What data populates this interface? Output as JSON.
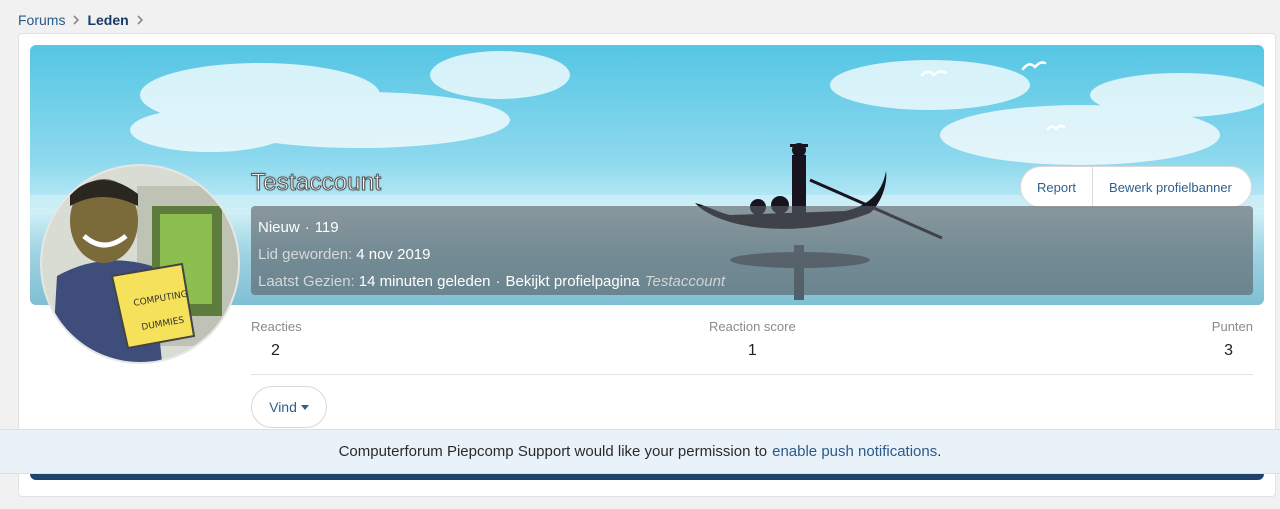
{
  "breadcrumb": {
    "items": [
      {
        "label": "Forums"
      },
      {
        "label": "Leden"
      }
    ]
  },
  "profile": {
    "username": "Testaccount",
    "title": "Nieuw",
    "separator": "·",
    "message_count": "119",
    "joined_label": "Lid geworden:",
    "joined_value": "4 nov 2019",
    "last_seen_label": "Laatst Gezien:",
    "last_seen_value": "14 minuten geleden",
    "last_seen_action": "Bekijkt profielpagina",
    "last_seen_target": "Testaccount"
  },
  "actions": {
    "report_label": "Report",
    "edit_banner_label": "Bewerk profielbanner"
  },
  "stats": [
    {
      "label": "Reacties",
      "value": "2"
    },
    {
      "label": "Reaction score",
      "value": "1"
    },
    {
      "label": "Punten",
      "value": "3"
    }
  ],
  "find": {
    "label": "Vind"
  },
  "push_notice": {
    "text": "Computerforum Piepcomp Support would like your permission to",
    "link": "enable push notifications",
    "suffix": "."
  },
  "icons": {
    "breadcrumb_separator": "chevron-right-icon",
    "find_dropdown": "caret-down-icon"
  },
  "colors": {
    "link": "#2a5a8a",
    "banner_sky": "#55c6e4",
    "tab_bar": "#1e446d",
    "notice_bg": "#eaf2f9"
  }
}
